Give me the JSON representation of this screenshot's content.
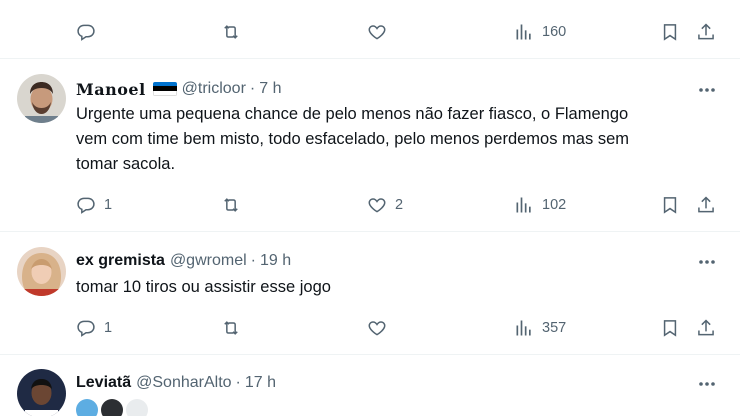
{
  "tweets": [
    {
      "actions": {
        "replies": "",
        "retweets": "",
        "likes": "",
        "views": "160"
      }
    },
    {
      "name": "Manoel",
      "handle": "@tricloor",
      "separator": "·",
      "time": "7 h",
      "text_lines": [
        "Urgente uma pequena chance de pelo menos não fazer fiasco, o Flamengo",
        "vem com time bem misto, todo esfacelado, pelo menos perdemos mas sem",
        "tomar sacola."
      ],
      "actions": {
        "replies": "1",
        "retweets": "",
        "likes": "2",
        "views": "102"
      }
    },
    {
      "name": "ex gremista",
      "handle": "@gwromel",
      "separator": "·",
      "time": "19 h",
      "text_lines": [
        "tomar 10 tiros ou assistir esse jogo"
      ],
      "actions": {
        "replies": "1",
        "retweets": "",
        "likes": "",
        "views": "357"
      }
    },
    {
      "name": "Leviatã",
      "handle": "@SonharAlto",
      "separator": "·",
      "time": "17 h"
    }
  ],
  "icons": {
    "reply": "reply-icon",
    "retweet": "retweet-icon",
    "like": "like-icon",
    "views": "views-icon",
    "bookmark": "bookmark-icon",
    "share": "share-icon",
    "more": "more-icon"
  },
  "colors": {
    "text": "#0f1419",
    "secondary": "#536471",
    "divider": "#eff3f4",
    "flag_top": "#0072ce",
    "flag_middle": "#000000",
    "flag_bottom": "#ffffff"
  }
}
